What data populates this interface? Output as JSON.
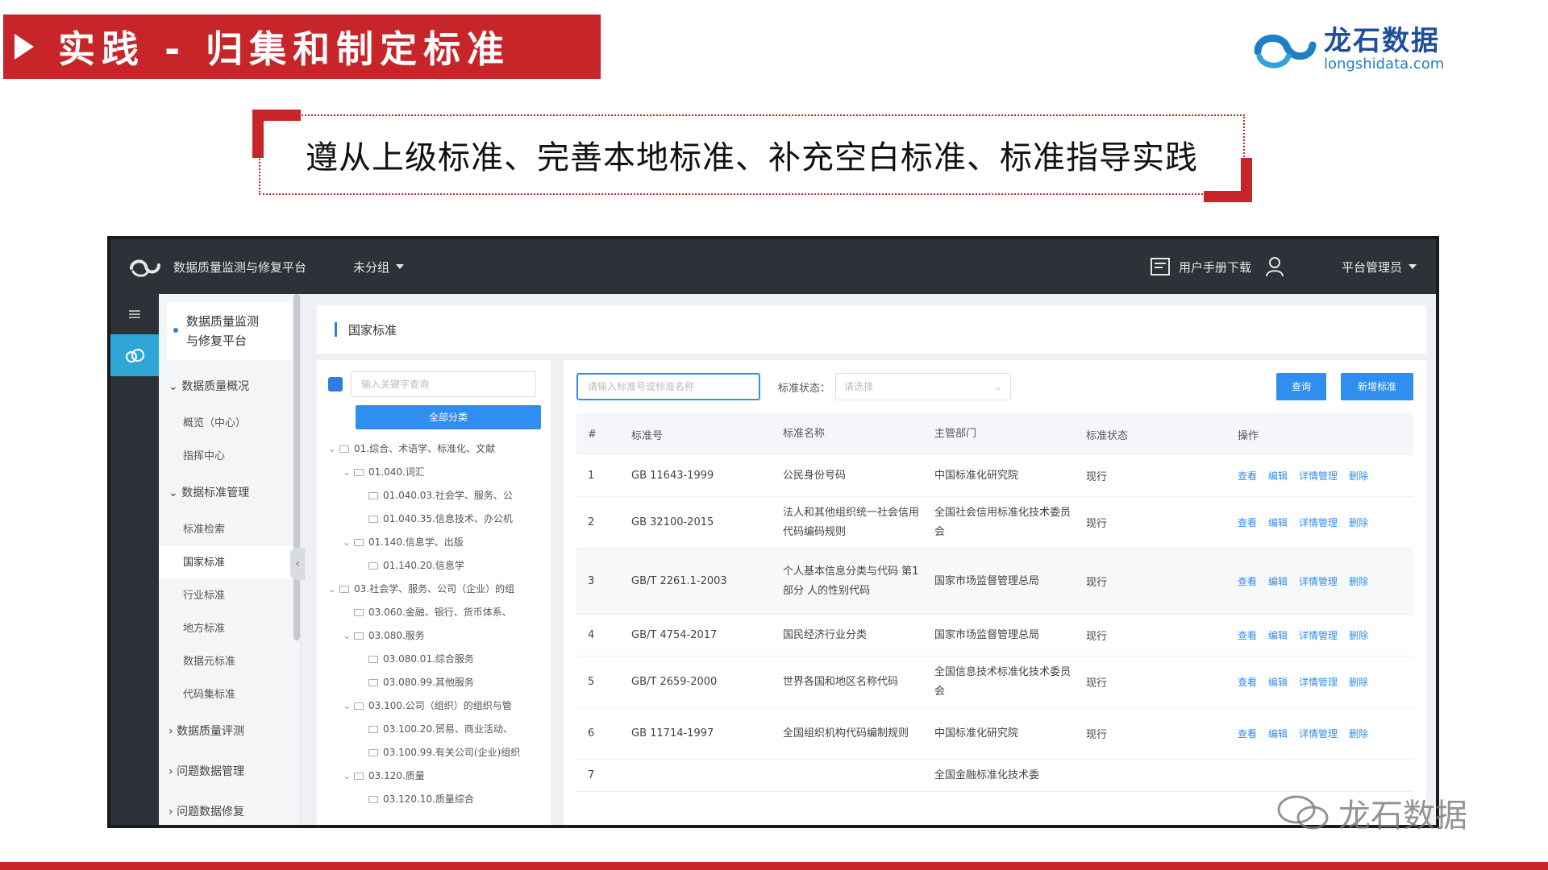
{
  "slide": {
    "title": "实践 - 归集和制定标准",
    "logo_cn": "龙石数据",
    "logo_en": "longshidata.com",
    "slogan": "遵从上级标准、完善本地标准、补充空白标准、标准指导实践",
    "watermark": "龙石数据",
    "accent_color": "#c8252a"
  },
  "topbar": {
    "app_name": "数据质量监测与修复平台",
    "group": "未分组",
    "manual": "用户手册下载",
    "admin": "平台管理员"
  },
  "sidebar": {
    "card_line1": "数据质量监测",
    "card_line2": "与修复平台",
    "group1": "数据质量概况",
    "item_overview": "概览（中心）",
    "item_board": "指挥中心",
    "group2": "数据标准管理",
    "item_std_search": "标准检索",
    "item_national": "国家标准",
    "item_industry": "行业标准",
    "item_local": "地方标准",
    "item_dataelem": "数据元标准",
    "item_code": "代码集标准",
    "group3": "数据质量评测",
    "group4": "问题数据管理",
    "group5": "问题数据修复"
  },
  "breadcrumb": {
    "title": "国家标准"
  },
  "tree": {
    "search_placeholder": "输入关键字查询",
    "all_button": "全部分类",
    "nodes": [
      "01.综合、术语学、标准化、文献",
      "01.040.词汇",
      "01.040.03.社会学、服务、公",
      "01.040.35.信息技术、办公机",
      "01.140.信息学、出版",
      "01.140.20.信息学",
      "03.社会学、服务、公司（企业）的组",
      "03.060.金融、银行、货币体系、",
      "03.080.服务",
      "03.080.01.综合服务",
      "03.080.99.其他服务",
      "03.100.公司（组织）的组织与管",
      "03.100.20.贸易、商业活动、",
      "03.100.99.有关公司(企业)组织",
      "03.120.质量",
      "03.120.10.质量综合"
    ]
  },
  "filters": {
    "search_placeholder": "请输入标准号或标准名称",
    "status_label": "标准状态：",
    "status_placeholder": "请选择",
    "query_button": "查询",
    "new_button": "新增标准"
  },
  "table": {
    "headers": [
      "#",
      "标准号",
      "标准名称",
      "主管部门",
      "标准状态",
      "操作"
    ],
    "ops": [
      "查看",
      "编辑",
      "详情管理",
      "删除"
    ],
    "rows": [
      {
        "no": "1",
        "code": "GB 11643-1999",
        "name": "公民身份号码",
        "dept": "中国标准化研究院",
        "status": "现行"
      },
      {
        "no": "2",
        "code": "GB 32100-2015",
        "name": "法人和其他组织统一社会信用代码编码规则",
        "dept": "全国社会信用标准化技术委员会",
        "status": "现行"
      },
      {
        "no": "3",
        "code": "GB/T 2261.1-2003",
        "name": "个人基本信息分类与代码 第1部分 人的性别代码",
        "dept": "国家市场监督管理总局",
        "status": "现行"
      },
      {
        "no": "4",
        "code": "GB/T 4754-2017",
        "name": "国民经济行业分类",
        "dept": "国家市场监督管理总局",
        "status": "现行"
      },
      {
        "no": "5",
        "code": "GB/T 2659-2000",
        "name": "世界各国和地区名称代码",
        "dept": "全国信息技术标准化技术委员会",
        "status": "现行"
      },
      {
        "no": "6",
        "code": "GB 11714-1997",
        "name": "全国组织机构代码编制规则",
        "dept": "中国标准化研究院",
        "status": "现行"
      },
      {
        "no": "7",
        "code": "",
        "name": "",
        "dept": "全国金融标准化技术委",
        "status": ""
      }
    ]
  }
}
